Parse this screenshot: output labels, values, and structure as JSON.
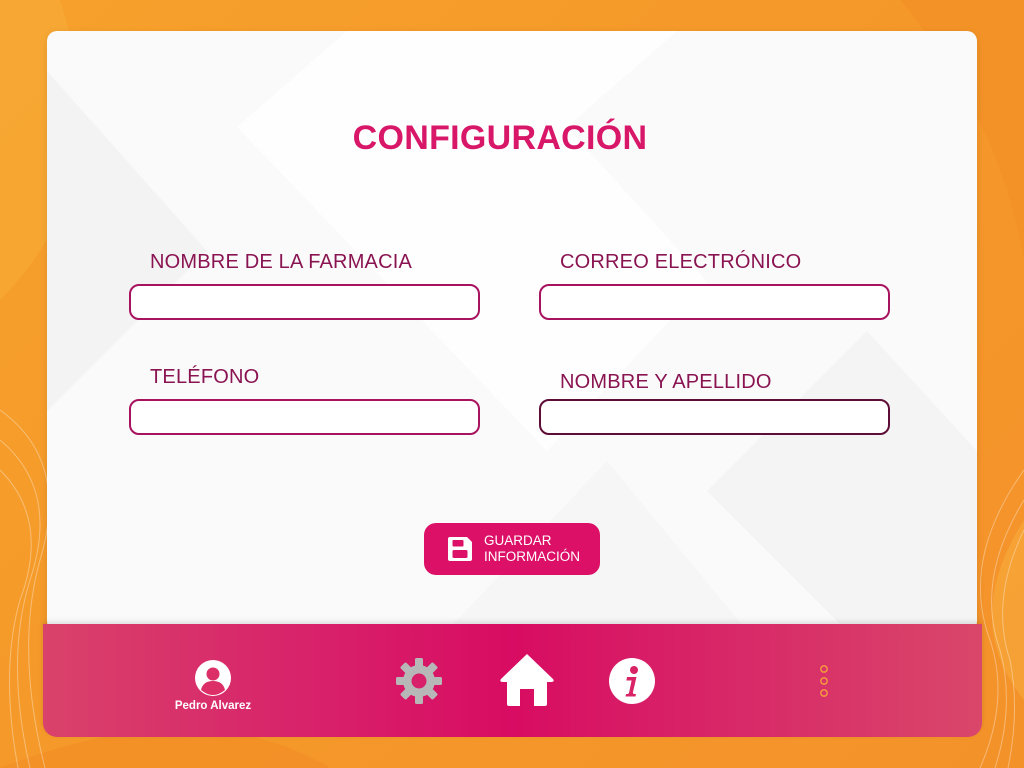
{
  "theme": {
    "accent": "#d81768",
    "label_color": "#8a1452",
    "background": "#f59a2a",
    "bar_color": "#d80c62"
  },
  "page": {
    "title": "CONFIGURACIÓN"
  },
  "form": {
    "pharmacy_name": {
      "label": "NOMBRE DE LA  FARMACIA",
      "value": "",
      "placeholder": ""
    },
    "email": {
      "label": "CORREO ELECTRÓNICO",
      "value": "",
      "placeholder": ""
    },
    "phone": {
      "label": "TELÉFONO",
      "value": "",
      "placeholder": ""
    },
    "full_name": {
      "label": "NOMBRE Y APELLIDO",
      "value": "",
      "placeholder": ""
    }
  },
  "actions": {
    "save_label": "GUARDAR\nINFORMACIÓN",
    "save_icon": "floppy-disk-icon"
  },
  "bottom_nav": {
    "user_name": "Pedro Alvarez",
    "avatar_icon": "user-avatar-icon",
    "items": [
      {
        "id": "settings",
        "icon": "gear-icon",
        "color": "#b7b7b7"
      },
      {
        "id": "home",
        "icon": "home-icon",
        "color": "#ffffff"
      },
      {
        "id": "info",
        "icon": "info-icon",
        "color": "#ffffff"
      }
    ],
    "more_icon": "vertical-dots-icon"
  }
}
